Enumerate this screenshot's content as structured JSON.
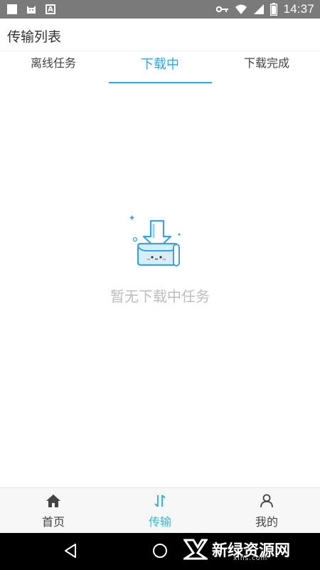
{
  "status_bar": {
    "time": "14:37",
    "notif_a_letter": "A",
    "battery_letter": "B"
  },
  "app": {
    "title": "传输列表"
  },
  "tabs": [
    {
      "label": "离线任务",
      "active": false
    },
    {
      "label": "下载中",
      "active": true
    },
    {
      "label": "下载完成",
      "active": false
    }
  ],
  "empty_state": {
    "message": "暂无下载中任务",
    "icon": "download-tray-icon"
  },
  "bottom_nav": [
    {
      "label": "首页",
      "icon": "home-icon",
      "active": false
    },
    {
      "label": "传输",
      "icon": "transfer-icon",
      "active": true
    },
    {
      "label": "我的",
      "icon": "user-icon",
      "active": false
    }
  ],
  "watermark": {
    "text": "新绿资源网",
    "sub": "xlhs.com"
  },
  "colors": {
    "accent": "#3aa3db",
    "nav_active": "#35b7c4",
    "status_bar": "#7a7a7a"
  }
}
